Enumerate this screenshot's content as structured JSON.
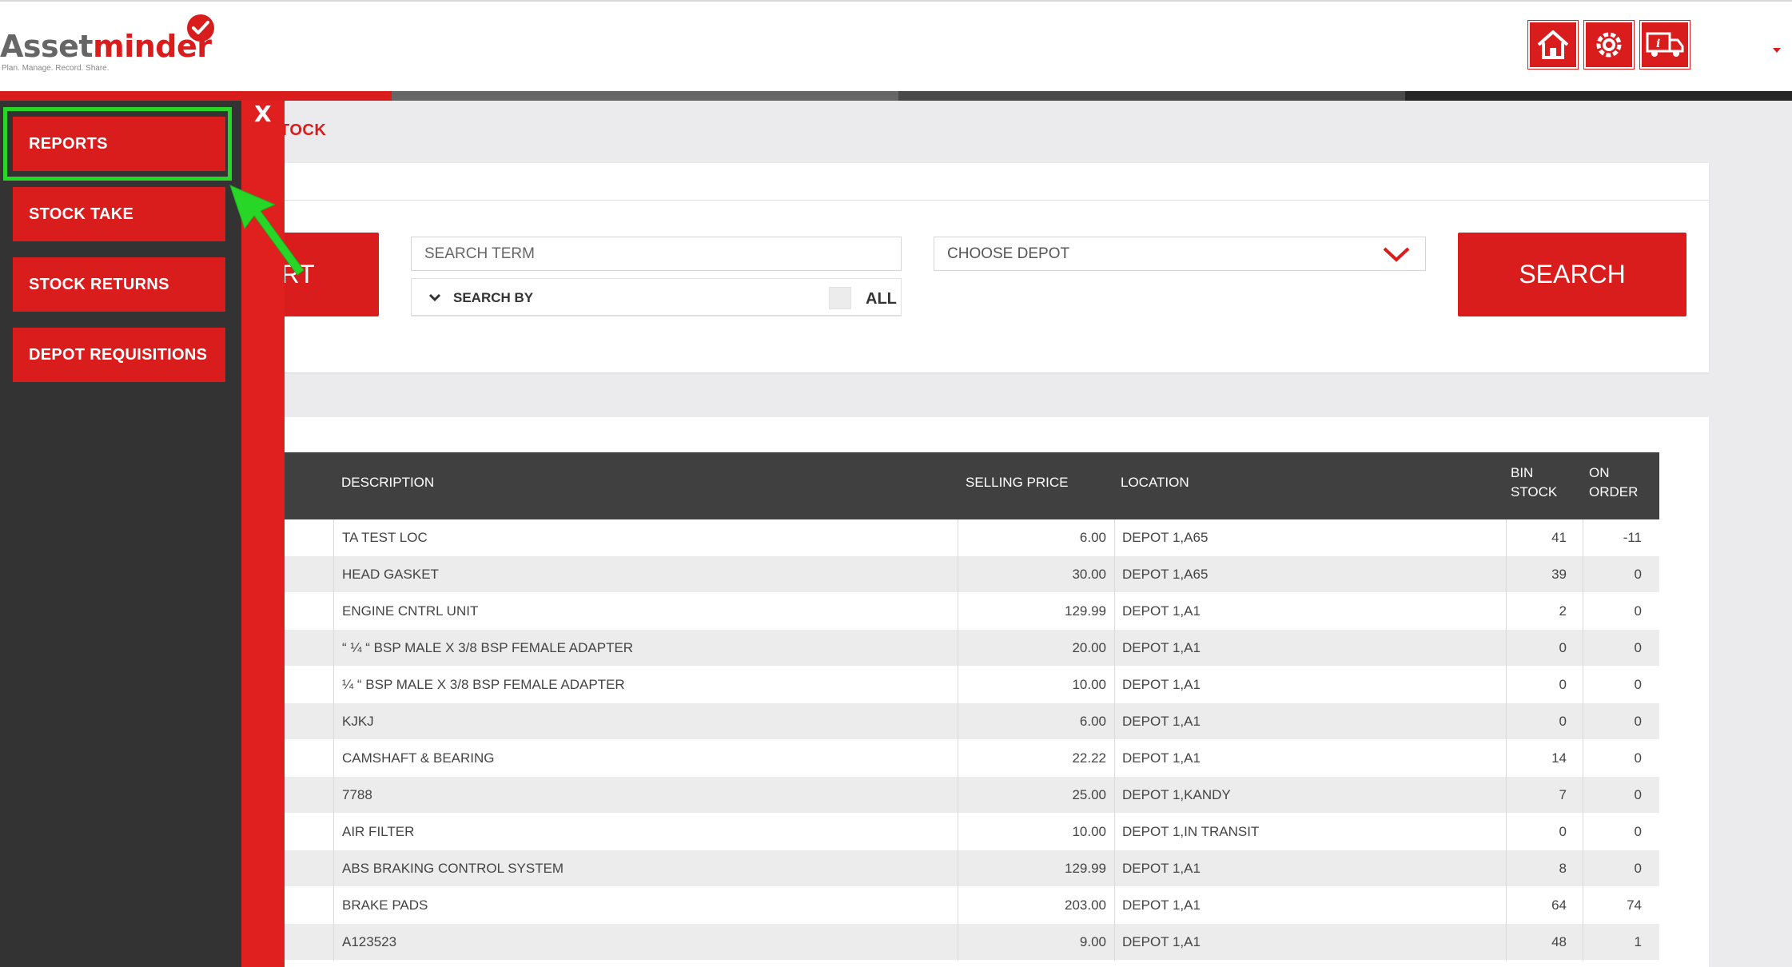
{
  "brand": {
    "name_part1": "Asset",
    "name_part2": "minder",
    "tagline": "Plan. Manage. Record. Share."
  },
  "header": {
    "icons": [
      "home-icon",
      "settings-gear-icon",
      "delivery-truck-icon"
    ]
  },
  "page": {
    "title": "TOCK"
  },
  "search": {
    "start_label": "ART",
    "term_placeholder": "SEARCH TERM",
    "search_by_label": "SEARCH BY",
    "all_label": "ALL",
    "depot_placeholder": "CHOOSE DEPOT",
    "search_label": "SEARCH"
  },
  "sidebar": {
    "close_label": "X",
    "items": [
      {
        "label": "REPORTS"
      },
      {
        "label": "STOCK TAKE"
      },
      {
        "label": "STOCK RETURNS"
      },
      {
        "label": "DEPOT REQUISITIONS"
      }
    ]
  },
  "table": {
    "headers": {
      "description": "DESCRIPTION",
      "selling_price": "SELLING PRICE",
      "location": "LOCATION",
      "bin_stock_1": "BIN",
      "bin_stock_2": "STOCK",
      "on_order_1": "ON",
      "on_order_2": "ORDER"
    },
    "rows": [
      {
        "description": "TA TEST LOC",
        "price": "6.00",
        "location": "DEPOT 1,A65",
        "bin": "41",
        "order": "-11"
      },
      {
        "description": "HEAD GASKET",
        "price": "30.00",
        "location": "DEPOT 1,A65",
        "bin": "39",
        "order": "0"
      },
      {
        "description": "ENGINE CNTRL UNIT",
        "price": "129.99",
        "location": "DEPOT 1,A1",
        "bin": "2",
        "order": "0"
      },
      {
        "description": "“ ¼ “ BSP MALE X 3/8 BSP FEMALE ADAPTER",
        "price": "20.00",
        "location": "DEPOT 1,A1",
        "bin": "0",
        "order": "0"
      },
      {
        "description": "¼ “ BSP MALE X 3/8 BSP FEMALE ADAPTER",
        "price": "10.00",
        "location": "DEPOT 1,A1",
        "bin": "0",
        "order": "0"
      },
      {
        "description": "KJKJ",
        "price": "6.00",
        "location": "DEPOT 1,A1",
        "bin": "0",
        "order": "0"
      },
      {
        "description": "CAMSHAFT & BEARING",
        "price": "22.22",
        "location": "DEPOT 1,A1",
        "bin": "14",
        "order": "0"
      },
      {
        "description": "7788",
        "price": "25.00",
        "location": "DEPOT 1,KANDY",
        "bin": "7",
        "order": "0"
      },
      {
        "description": "AIR FILTER",
        "price": "10.00",
        "location": "DEPOT 1,IN TRANSIT",
        "bin": "0",
        "order": "0"
      },
      {
        "description": "ABS BRAKING CONTROL SYSTEM",
        "price": "129.99",
        "location": "DEPOT 1,A1",
        "bin": "8",
        "order": "0"
      },
      {
        "description": "BRAKE PADS",
        "price": "203.00",
        "location": "DEPOT 1,A1",
        "bin": "64",
        "order": "74"
      },
      {
        "description": "A123523",
        "price": "9.00",
        "location": "DEPOT 1,A1",
        "bin": "48",
        "order": "1"
      }
    ]
  },
  "colors": {
    "accent": "#d91c1c",
    "sidebar": "#333333",
    "table_header": "#404040",
    "highlight": "#27d627"
  }
}
